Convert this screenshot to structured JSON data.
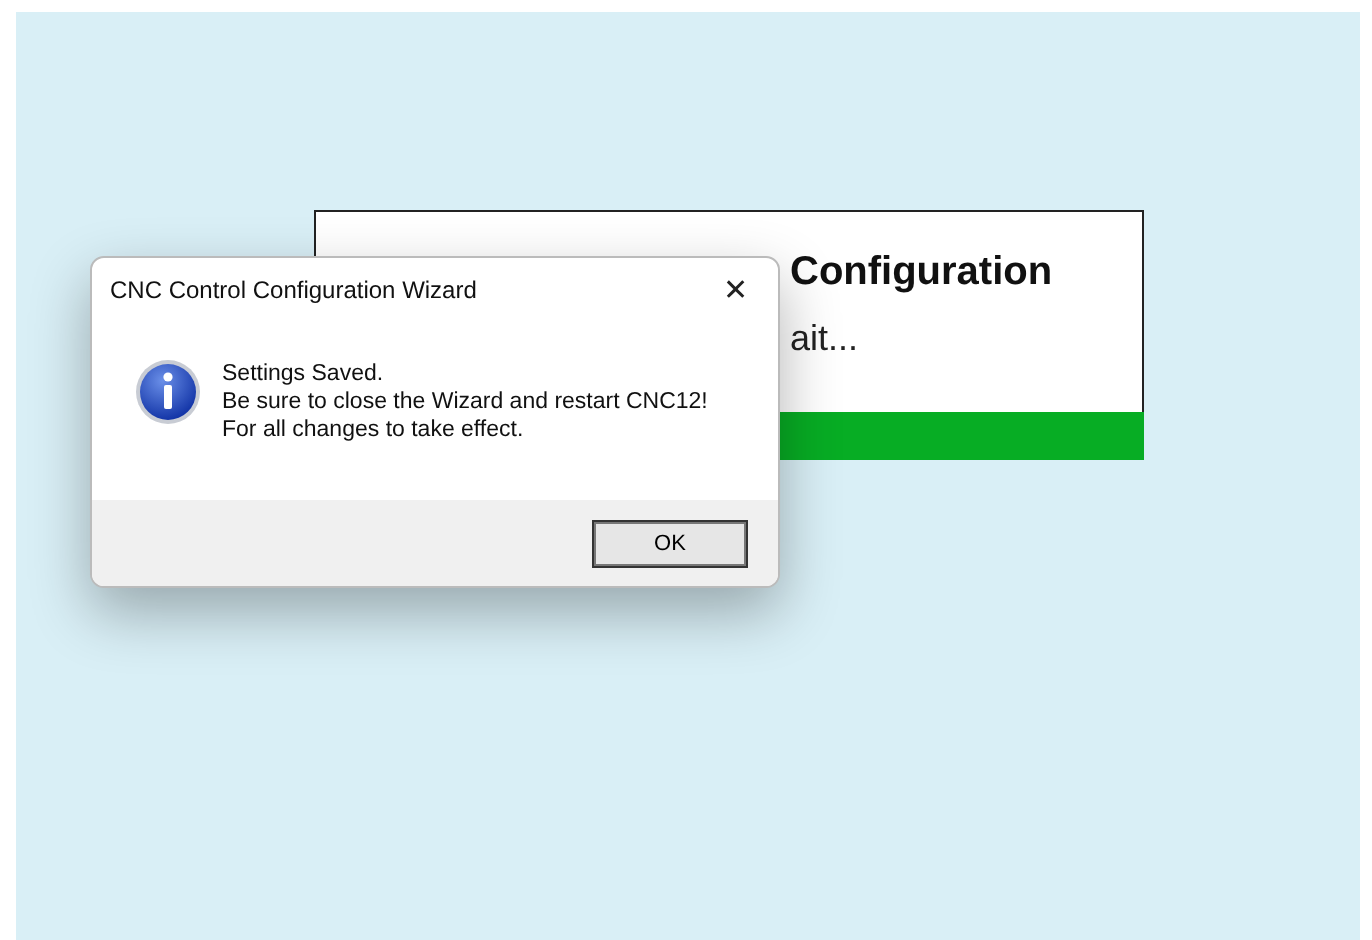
{
  "splash": {
    "heading": "Configuration",
    "status": "ait...",
    "progress": {
      "level": 1
    }
  },
  "dialog": {
    "title": "CNC Control Configuration Wizard",
    "close": "✕",
    "message": [
      "Settings Saved.",
      "Be sure to close the Wizard and restart CNC12!",
      "For all changes to take effect."
    ],
    "buttons": [
      {
        "label": "OK",
        "default": true
      }
    ]
  }
}
